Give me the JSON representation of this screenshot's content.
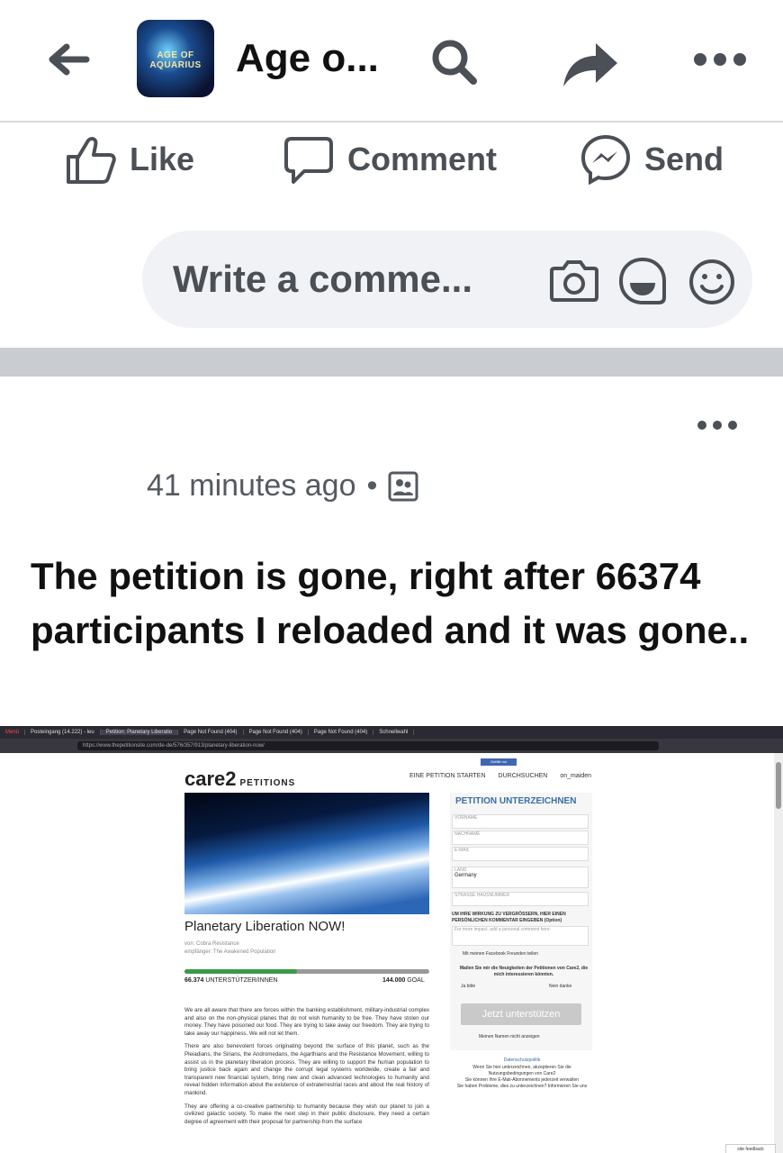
{
  "topbar": {
    "page_icon_text": "AGE OF AQUARIUS",
    "page_title": "Age o..."
  },
  "actions": {
    "like": "Like",
    "comment": "Comment",
    "send": "Send"
  },
  "comment_input": {
    "placeholder": "Write a comme..."
  },
  "post": {
    "timestamp": "41 minutes ago",
    "separator": "•",
    "text": "The petition is gone, right after 66374 participants I reloaded and it was gone.."
  },
  "screenshot": {
    "browser": {
      "tabs": [
        "Menü",
        "Posteingang (14.222) - leu",
        "Petition: Planetary Liberatio",
        "Page Not Found (404)",
        "Page Not Found (404)",
        "Page Not Found (404)",
        "Schnellwahl"
      ],
      "url": "https://www.thepetitionsite.com/de-de/576/357/913/planetary-liberation-now/"
    },
    "site": {
      "logo": "care2",
      "logo_sub": "PETITIONS",
      "fb_like": "Gefällt mir",
      "nav": [
        "EINE PETITION STARTEN",
        "DURCHSUCHEN",
        "on_maiden"
      ],
      "petition_title": "Planetary Liberation NOW!",
      "from": "von: Cobra Resistance",
      "recipient": "empfänger: The Awakened Population",
      "supporters": "66.374",
      "supporters_label": "UNTERSTÜTZER/INNEN",
      "goal": "144.000",
      "goal_label": "GOAL",
      "progress": 0.46,
      "paragraphs": [
        "We are all aware that there are forces within the banking establishment, military-industrial complex and also on the non-physical planes that do not wish humanity to be free. They have stolen our money. They have poisoned our food. They are trying to take away our freedom. They are trying to take away our happiness. We will not let them.",
        "There are also benevolent forces originating beyond the surface of this planet, such as the Pleiadians, the Sirians, the Andromedans, the Agarthians and the Resistance Movement, willing to assist us in the planetary liberation process. They are willing to support the human population to bring justice back again and change the corrupt legal systems worldwide, create a fair and transparent new financial system, bring new and clean advanced technologies to humanity and reveal hidden information about the existence of extraterrestrial races and about the real history of mankind.",
        "They are offering a co-creative partnership to humanity because they wish our planet to join a civilized galactic society. To make the next step in their public disclosure, they need a certain degree of agreement with their proposal for partnership from the surface"
      ],
      "form": {
        "heading": "PETITION UNTERZEICHNEN",
        "firstname": "VORNAME",
        "lastname": "NACHNAME",
        "email": "E-MAIL",
        "country_label": "LAND",
        "country": "Germany",
        "street": "STRASSE HAUSNUMMER",
        "comment_label": "UM IHRE WIRKUNG ZU VERGRÖSSERN, HIER EINEN PERSÖNLICHEN KOMMENTAR EINGEBEN (Option)",
        "comment_placeholder": "For more impact, add a personal comment here",
        "fb_share": "Mit meinen Facebook Freunden teilen",
        "news_question": "Mailen Sie mir die Neuigkeiten der Petitionen von Care2, die mich interessieren könnten.",
        "yes": "Ja bitte",
        "no": "Nein danke",
        "submit": "Jetzt unterstützen",
        "hide_name": "Meinen Namen nicht anzeigen",
        "privacy": "Datenschutzpolitik",
        "terms": "Wenn Sie hier unterzeichnen, akzeptieren Sie die Nutzungsbedingungen von Care2",
        "unsubscribe": "Sie können Ihre E-Mail-Abonnements jederzeit verwalten",
        "problems": "Sie haben Probleme, dies zu unterzeichnen? Informieren Sie uns"
      },
      "feedback": "site feedback"
    }
  }
}
